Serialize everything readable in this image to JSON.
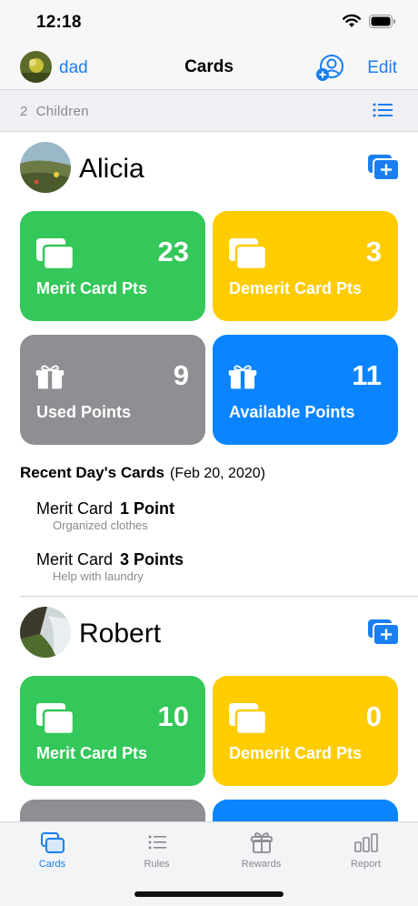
{
  "status_bar": {
    "time": "12:18",
    "icons": [
      "wifi-icon",
      "battery-icon"
    ]
  },
  "nav": {
    "user": "dad",
    "title": "Cards",
    "edit_label": "Edit"
  },
  "group": {
    "count": "2",
    "label": "Children"
  },
  "children": [
    {
      "name": "Alicia",
      "tiles": [
        {
          "value": "23",
          "label": "Merit Card Pts",
          "color": "#34c759",
          "icon": "cards-icon"
        },
        {
          "value": "3",
          "label": "Demerit Card Pts",
          "color": "#ffcc00",
          "icon": "cards-icon"
        },
        {
          "value": "9",
          "label": "Used Points",
          "color": "#8e8e93",
          "icon": "gift-icon"
        },
        {
          "value": "11",
          "label": "Available Points",
          "color": "#0a84ff",
          "icon": "gift-icon"
        }
      ],
      "recent": {
        "title": "Recent Day's Cards",
        "date": "(Feb 20, 2020)",
        "items": [
          {
            "type": "Merit Card",
            "points": "1 Point",
            "description": "Organized clothes"
          },
          {
            "type": "Merit Card",
            "points": "3 Points",
            "description": "Help with laundry"
          }
        ]
      }
    },
    {
      "name": "Robert",
      "tiles": [
        {
          "value": "10",
          "label": "Merit Card Pts",
          "color": "#34c759",
          "icon": "cards-icon"
        },
        {
          "value": "0",
          "label": "Demerit Card Pts",
          "color": "#ffcc00",
          "icon": "cards-icon"
        },
        {
          "value": "",
          "label": "",
          "color": "#8e8e93",
          "icon": ""
        },
        {
          "value": "",
          "label": "",
          "color": "#0a84ff",
          "icon": ""
        }
      ]
    }
  ],
  "tabs": [
    {
      "label": "Cards",
      "icon": "cards-icon",
      "active": true
    },
    {
      "label": "Rules",
      "icon": "list-icon",
      "active": false
    },
    {
      "label": "Rewards",
      "icon": "gift-icon",
      "active": false
    },
    {
      "label": "Report",
      "icon": "bar-chart-icon",
      "active": false
    }
  ],
  "colors": {
    "accent": "#1a7ff0",
    "merit": "#34c759",
    "demerit": "#ffcc00",
    "used": "#8e8e93",
    "available": "#0a84ff"
  }
}
